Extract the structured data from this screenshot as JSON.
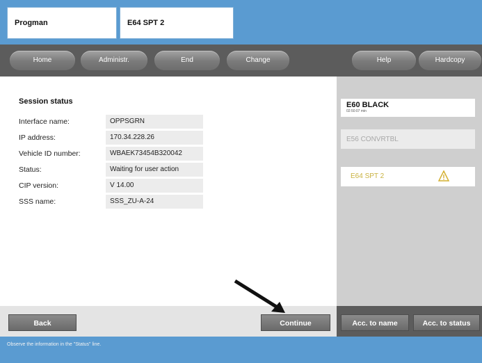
{
  "header": {
    "tab1": "Progman",
    "tab2": "E64 SPT 2"
  },
  "nav": {
    "home": "Home",
    "administration": "Administr.",
    "end": "End",
    "change": "Change",
    "help": "Help",
    "hardcopy": "Hardcopy"
  },
  "session": {
    "title": "Session status",
    "rows": [
      {
        "label": "Interface name:",
        "value": "OPPSGRN"
      },
      {
        "label": "IP address:",
        "value": "170.34.228.26"
      },
      {
        "label": "Vehicle ID number:",
        "value": "WBAEK73454B320042"
      },
      {
        "label": "Status:",
        "value": "Waiting for user action"
      },
      {
        "label": "CIP version:",
        "value": "V 14.00"
      },
      {
        "label": "SSS name:",
        "value": "SSS_ZU-A-24"
      }
    ]
  },
  "vehicles": [
    {
      "name": "E60 BLACK",
      "sub": "02:50:07 min"
    },
    {
      "name": "E56 CONVRTBL"
    },
    {
      "name": "E64 SPT 2",
      "icon": "warning-icon"
    }
  ],
  "buttons": {
    "back": "Back",
    "continue": "Continue",
    "acc_name": "Acc. to name",
    "acc_status": "Acc. to status"
  },
  "status_message": "Observe the information in the \"Status\" line.",
  "colors": {
    "header_blue": "#5a9bd1",
    "band_gray": "#5c5c5c",
    "panel_gray": "#cfcfcf",
    "warning_yellow": "#c9b240"
  }
}
